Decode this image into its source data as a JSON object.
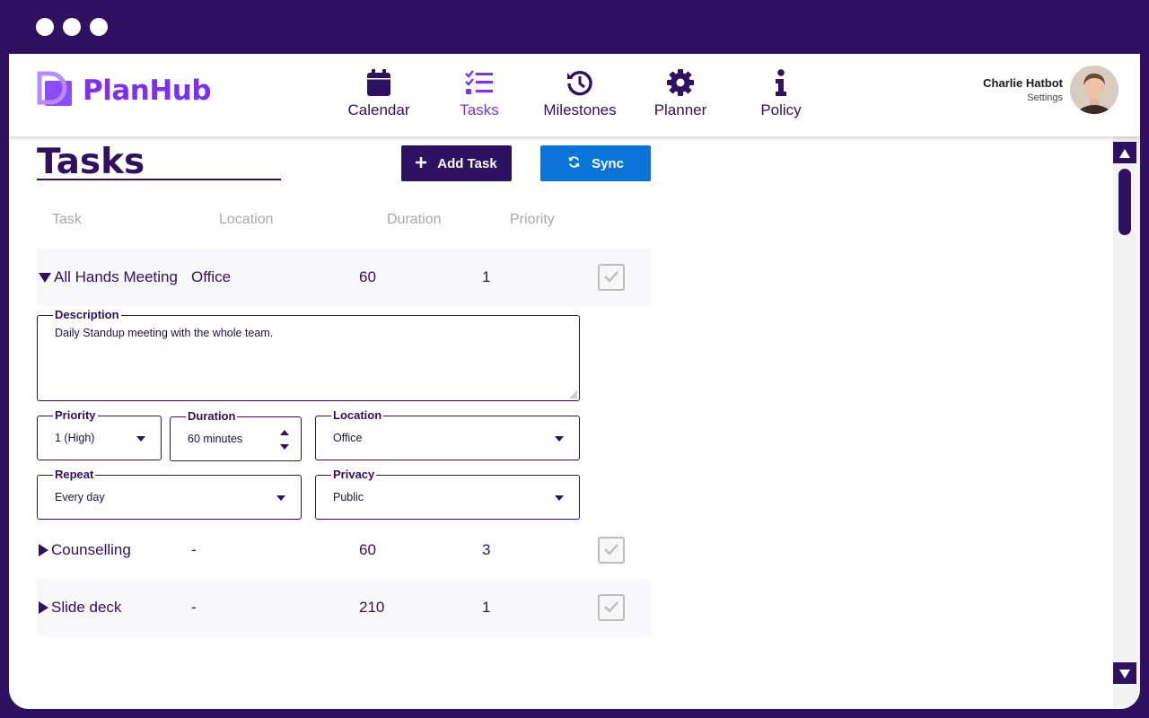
{
  "app": {
    "name": "PlanHub"
  },
  "colors": {
    "primary": "#2e1160",
    "accent": "#7b2ff7",
    "sync": "#0a74d8"
  },
  "nav": {
    "items": [
      {
        "label": "Calendar",
        "icon": "calendar-icon"
      },
      {
        "label": "Tasks",
        "icon": "tasks-icon",
        "active": true
      },
      {
        "label": "Milestones",
        "icon": "history-icon"
      },
      {
        "label": "Planner",
        "icon": "gear-icon"
      },
      {
        "label": "Policy",
        "icon": "info-icon"
      }
    ]
  },
  "user": {
    "name": "Charlie Hatbot",
    "settings_label": "Settings"
  },
  "page": {
    "title": "Tasks"
  },
  "toolbar": {
    "add_label": "Add Task",
    "sync_label": "Sync"
  },
  "table": {
    "columns": [
      "Task",
      "Location",
      "Duration",
      "Priority"
    ],
    "rows": [
      {
        "task": "All Hands Meeting",
        "location": "Office",
        "duration": "60",
        "priority": "1",
        "expanded": true,
        "done": true
      },
      {
        "task": "Counselling",
        "location": "-",
        "duration": "60",
        "priority": "3",
        "expanded": false,
        "done": true
      },
      {
        "task": "Slide deck",
        "location": "-",
        "duration": "210",
        "priority": "1",
        "expanded": false,
        "done": true
      }
    ]
  },
  "detail": {
    "description_label": "Description",
    "description_value": "Daily Standup meeting with the whole team.",
    "priority_label": "Priority",
    "priority_value": "1 (High)",
    "duration_label": "Duration",
    "duration_value": "60 minutes",
    "location_label": "Location",
    "location_value": "Office",
    "repeat_label": "Repeat",
    "repeat_value": "Every day",
    "privacy_label": "Privacy",
    "privacy_value": "Public"
  }
}
